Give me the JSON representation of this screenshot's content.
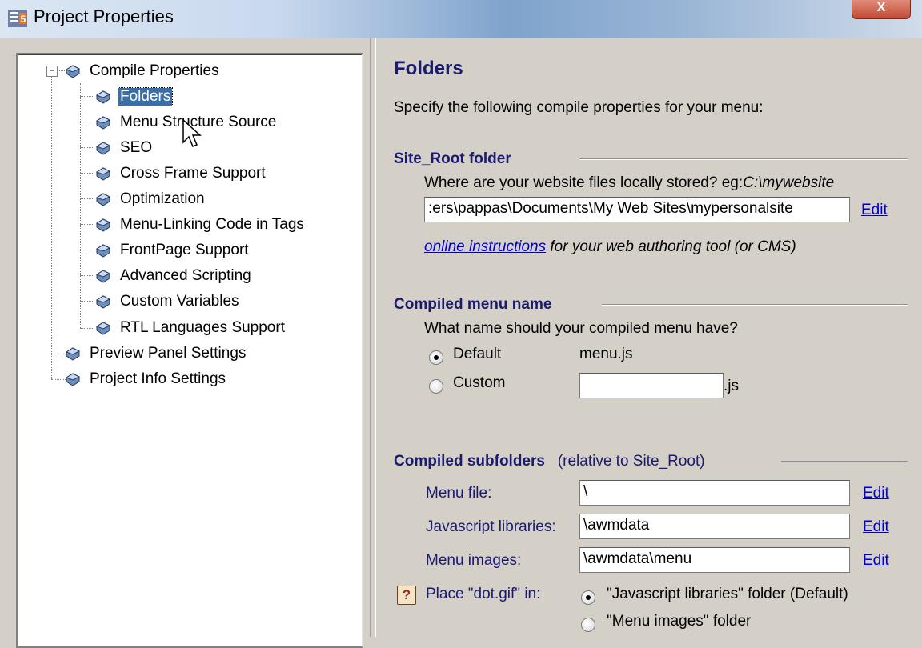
{
  "window": {
    "title": "Project Properties",
    "close_label": "X"
  },
  "tree": {
    "expander": "−",
    "root": "Compile Properties",
    "children": [
      "Folders",
      "Menu Structure Source",
      "SEO",
      "Cross Frame Support",
      "Optimization",
      "Menu-Linking Code in Tags",
      "FrontPage Support",
      "Advanced Scripting",
      "Custom Variables",
      "RTL Languages Support"
    ],
    "top_level": [
      "Preview Panel Settings",
      "Project Info Settings"
    ],
    "selected": "Folders"
  },
  "panel": {
    "title": "Folders",
    "intro": "Specify the following compile properties for your menu:",
    "site_root": {
      "heading": "Site_Root folder",
      "question_prefix": "Where are your website files locally stored?  eg:",
      "question_example": "C:\\mywebsite",
      "value": ":ers\\pappas\\Documents\\My Web Sites\\mypersonalsite",
      "edit": "Edit",
      "instructions_link": "online instructions",
      "instructions_rest": " for your web authoring tool (or CMS)"
    },
    "menu_name": {
      "heading": "Compiled menu name",
      "question": "What name should your compiled menu have?",
      "default_label": "Default",
      "default_value": "menu.js",
      "custom_label": "Custom",
      "custom_value": "",
      "custom_ext": ".js",
      "selected": "Default"
    },
    "subfolders": {
      "heading": "Compiled subfolders",
      "note": "(relative to Site_Root)",
      "rows": [
        {
          "label": "Menu file:",
          "value": "\\",
          "edit": "Edit"
        },
        {
          "label": "Javascript libraries:",
          "value": "\\awmdata",
          "edit": "Edit"
        },
        {
          "label": "Menu images:",
          "value": "\\awmdata\\menu",
          "edit": "Edit"
        }
      ],
      "help": "?",
      "dotgif_label": "Place \"dot.gif\" in:",
      "dotgif_options": [
        "\"Javascript libraries\" folder (Default)",
        "\"Menu images\" folder"
      ],
      "dotgif_selected": 0
    }
  }
}
